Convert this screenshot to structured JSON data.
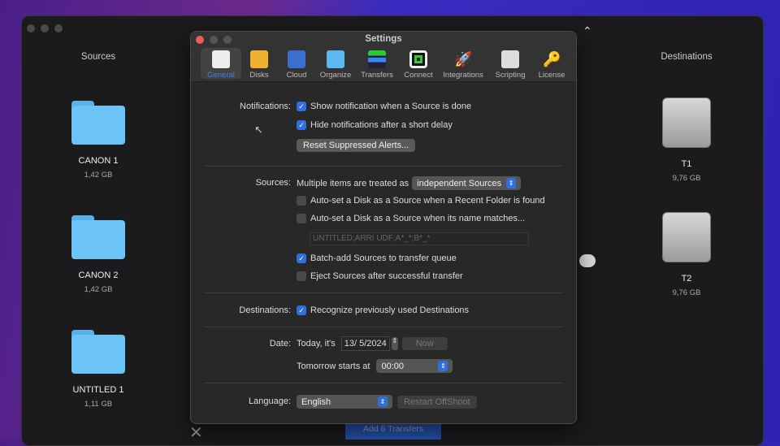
{
  "main": {
    "sources_header": "Sources",
    "destinations_header": "Destinations",
    "sources": [
      {
        "name": "CANON 1",
        "size": "1,42 GB"
      },
      {
        "name": "CANON 2",
        "size": "1,42 GB"
      },
      {
        "name": "UNTITLED 1",
        "size": "1,11 GB"
      }
    ],
    "destinations": [
      {
        "name": "T1",
        "size": "9,76 GB"
      },
      {
        "name": "T2",
        "size": "9,76 GB"
      }
    ],
    "add_button": "Add 6 Transfers"
  },
  "settings": {
    "title": "Settings",
    "tabs": [
      {
        "label": "General",
        "icon": "switch-icon"
      },
      {
        "label": "Disks",
        "icon": "disk-icon"
      },
      {
        "label": "Cloud",
        "icon": "cloud-icon"
      },
      {
        "label": "Organize",
        "icon": "folder-icon"
      },
      {
        "label": "Transfers",
        "icon": "transfers-icon"
      },
      {
        "label": "Connect",
        "icon": "connect-icon"
      },
      {
        "label": "Integrations",
        "icon": "rocket-icon"
      },
      {
        "label": "Scripting",
        "icon": "script-icon"
      },
      {
        "label": "License",
        "icon": "key-icon"
      }
    ],
    "notifications_label": "Notifications:",
    "show_notification": "Show notification when a Source is done",
    "hide_notifications": "Hide notifications after a short delay",
    "reset_alerts": "Reset Suppressed Alerts...",
    "sources_label": "Sources:",
    "multiple_items": "Multiple items are treated as",
    "treatment": "independent Sources",
    "auto_recent": "Auto-set a Disk as a Source when a Recent Folder is found",
    "auto_name": "Auto-set a Disk as a Source when its name matches...",
    "name_pattern": "UNTITLED;ARRI UDF;A*_*;B*_*",
    "batch_add": "Batch-add Sources to transfer queue",
    "eject": "Eject Sources after successful transfer",
    "destinations_label": "Destinations:",
    "recognize": "Recognize previously used Destinations",
    "date_label": "Date:",
    "today": "Today, it's",
    "date_value": "13/  5/2024",
    "now": "Now",
    "tomorrow": "Tomorrow starts at",
    "tomorrow_value": "00:00",
    "language_label": "Language:",
    "language": "English",
    "restart": "Restart OffShoot"
  }
}
